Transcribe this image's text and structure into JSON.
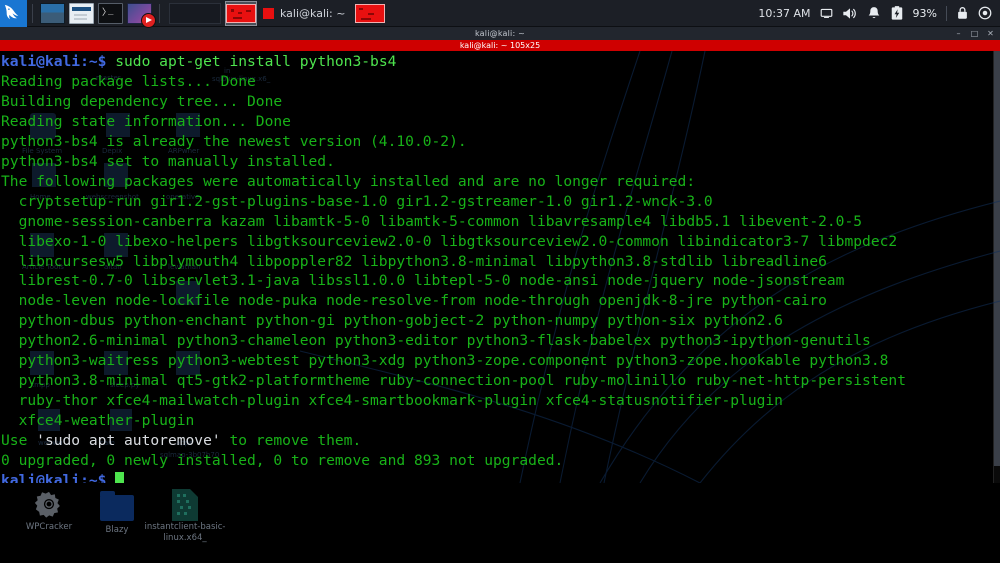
{
  "panel": {
    "kali_logo": "kali-dragon-logo",
    "launchers": [
      {
        "name": "show-desktop-launcher",
        "icon": "window-icon"
      },
      {
        "name": "file-manager-launcher",
        "icon": "folder-icon"
      },
      {
        "name": "terminal-launcher",
        "icon": "terminal-icon"
      },
      {
        "name": "virtualbox-launcher",
        "icon": "vm-record-icon"
      }
    ],
    "workspace_switcher": "workspace-switcher",
    "window_thumbnails": [
      {
        "name": "window-thumb-active",
        "active": true
      },
      {
        "name": "window-thumb-secondary",
        "active": false
      }
    ],
    "task_button": {
      "label": "kali@kali: ~",
      "icon": "window-square-icon"
    },
    "tray": {
      "clock": "10:37 AM",
      "display_icon": "display-icon",
      "volume_icon": "volume-icon",
      "notification_icon": "bell-icon",
      "battery_icon": "battery-charging-icon",
      "battery_percent": "93%",
      "lock_icon": "lock-icon",
      "power_icon": "power-icon"
    }
  },
  "window": {
    "title": "kali@kali: ~",
    "tab_title": "kali@kali: ~ 105x25",
    "controls": {
      "minimize": "–",
      "maximize": "□",
      "close": "✕"
    }
  },
  "terminal": {
    "prompt": "kali@kali:~$",
    "command": "sudo apt-get install python3-bs4",
    "lines": [
      "Reading package lists... Done",
      "Building dependency tree... Done",
      "Reading state information... Done",
      "python3-bs4 is already the newest version (4.10.0-2).",
      "python3-bs4 set to manually installed.",
      "The following packages were automatically installed and are no longer required:",
      "  cryptsetup-run gir1.2-gst-plugins-base-1.0 gir1.2-gstreamer-1.0 gir1.2-wnck-3.0",
      "  gnome-session-canberra kazam libamtk-5-0 libamtk-5-common libavresample4 libdb5.1 libevent-2.0-5",
      "  libexo-1-0 libexo-helpers libgtksourceview2.0-0 libgtksourceview2.0-common libindicator3-7 libmpdec2",
      "  libncursesw5 libplymouth4 libpoppler82 libpython3.8-minimal libpython3.8-stdlib libreadline6",
      "  librest-0.7-0 libservlet3.1-java libssl1.0.0 libtepl-5-0 node-ansi node-jquery node-jsonstream",
      "  node-leven node-lockfile node-puka node-resolve-from node-through openjdk-8-jre python-cairo",
      "  python-dbus python-enchant python-gi python-gobject-2 python-numpy python-six python2.6",
      "  python2.6-minimal python3-chameleon python3-editor python3-flask-babelex python3-ipython-genutils",
      "  python3-waitress python3-webtest python3-xdg python3-zope.component python3-zope.hookable python3.8",
      "  python3.8-minimal qt5-gtk2-platformtheme ruby-connection-pool ruby-molinillo ruby-net-http-persistent",
      "  ruby-thor xfce4-mailwatch-plugin xfce4-smartbookmark-plugin xfce4-statusnotifier-plugin",
      "  xfce4-weather-plugin"
    ],
    "autoremove_prefix": "Use ",
    "autoremove_quoted": "'sudo apt autoremove'",
    "autoremove_suffix": " to remove them.",
    "summary": "0 upgraded, 0 newly installed, 0 to remove and 893 not upgraded.",
    "final_prompt": "kali@kali:~$"
  },
  "desktop": {
    "icons": [
      {
        "label": "WPCracker",
        "icon": "gear-icon"
      },
      {
        "label": "Blazy",
        "icon": "folder-icon"
      },
      {
        "label": "instantclient-basic-linux.x64_",
        "icon": "file-icon"
      }
    ],
    "ghost_labels": [
      "master",
      "in",
      "sqlplus-linux.x6_",
      "File System",
      "Depix",
      "ARPwner",
      "Home",
      "webscreenshot",
      "operative-",
      "Article Tools",
      "altair",
      "leviathan",
      "xmpp",
      "sleep.py",
      "webwu",
      "cam",
      "appr",
      "sqlmap-3b07b70"
    ]
  },
  "colors": {
    "panel_bg": "#1c1f26",
    "terminal_green": "#18b218",
    "prompt_blue": "#4169e1",
    "tab_red": "#cf0000",
    "accent_blue": "#1976d2"
  }
}
